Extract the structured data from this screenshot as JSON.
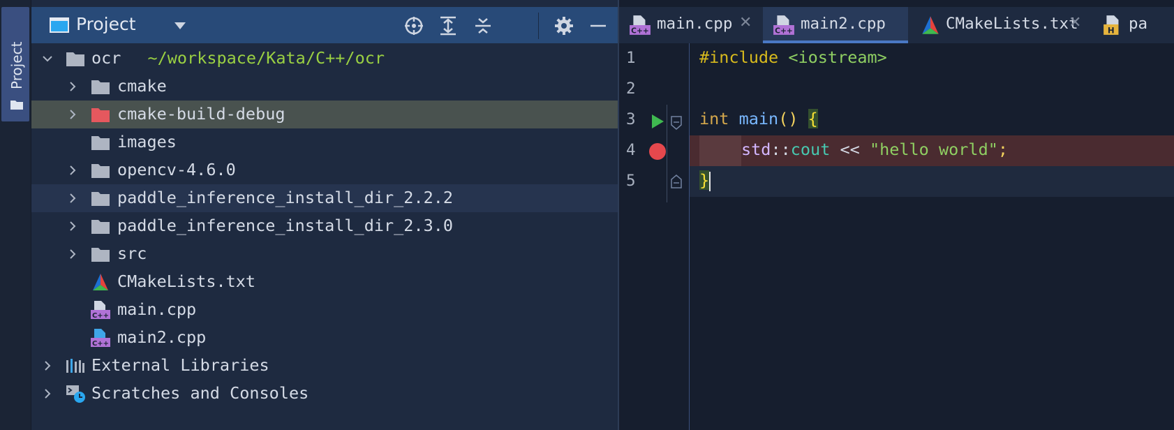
{
  "stripe": {
    "label": "Project"
  },
  "panel": {
    "title": "Project",
    "tools": [
      "locate-icon",
      "expand-all-icon",
      "collapse-all-icon",
      "gear-icon",
      "minimize-icon"
    ]
  },
  "tree": {
    "root": {
      "name": "ocr",
      "path": "~/workspace/Kata/C++/ocr"
    },
    "items": [
      {
        "label": "cmake"
      },
      {
        "label": "cmake-build-debug"
      },
      {
        "label": "images"
      },
      {
        "label": "opencv-4.6.0"
      },
      {
        "label": "paddle_inference_install_dir_2.2.2"
      },
      {
        "label": "paddle_inference_install_dir_2.3.0"
      },
      {
        "label": "src"
      },
      {
        "label": "CMakeLists.txt"
      },
      {
        "label": "main.cpp"
      },
      {
        "label": "main2.cpp"
      }
    ],
    "external": "External Libraries",
    "scratches": "Scratches and Consoles"
  },
  "tabs": [
    {
      "label": "main.cpp"
    },
    {
      "label": "main2.cpp"
    },
    {
      "label": "CMakeLists.txt"
    },
    {
      "label": "pa"
    }
  ],
  "code": {
    "line_numbers": [
      "1",
      "2",
      "3",
      "4",
      "5"
    ],
    "l1_directive": "#include",
    "l1_header": " <iostream>",
    "l3_type": "int",
    "l3_fn": " main",
    "l3_parens": "()",
    "l3_brace": "{",
    "l4_ns": "std",
    "l4_sep": "::",
    "l4_ident": "cout",
    "l4_op": " << ",
    "l4_str": "\"hello world\"",
    "l4_semi": ";",
    "l5_brace": "}"
  },
  "colors": {
    "accent": "#4a78c4",
    "selection": "#49524f",
    "breakpoint": "#e5484d",
    "run": "#3fb950"
  }
}
